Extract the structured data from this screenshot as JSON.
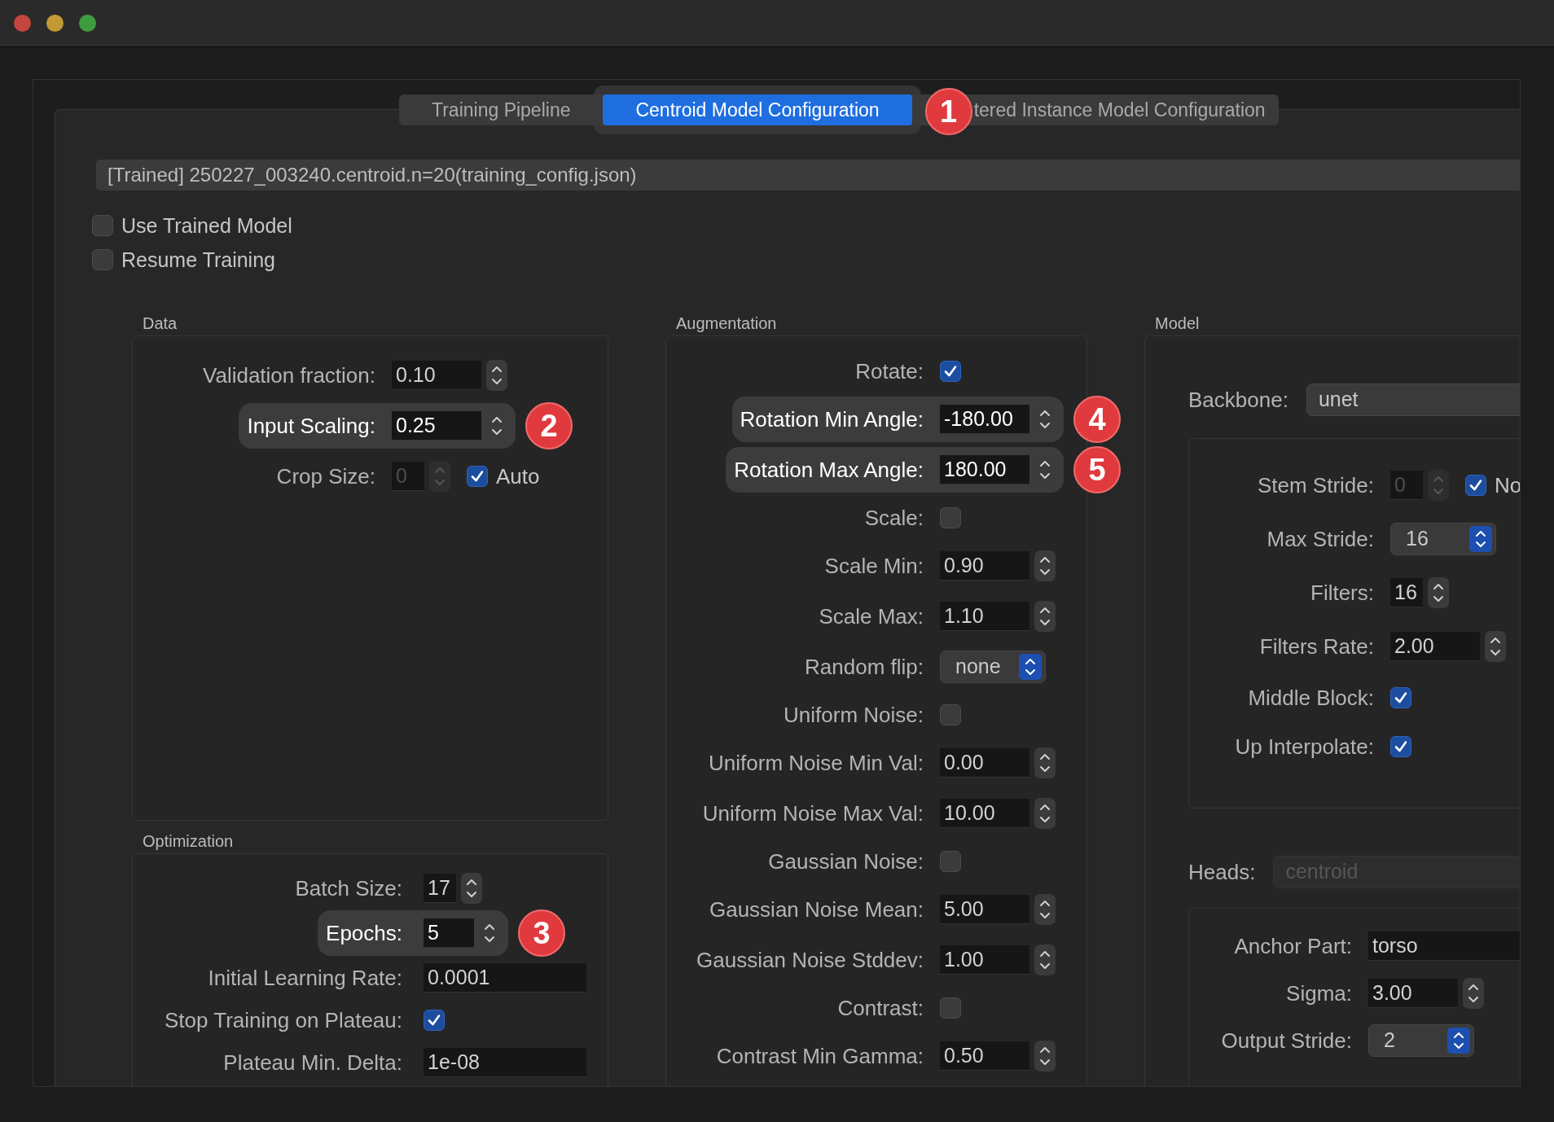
{
  "tabs": [
    {
      "label": "Training Pipeline",
      "selected": false
    },
    {
      "label": "Centroid Model Configuration",
      "selected": true,
      "callout": "1"
    },
    {
      "label": "tered Instance Model Configuration",
      "selected": false
    }
  ],
  "model_path": "[Trained] 250227_003240.centroid.n=20(training_config.json)",
  "options": [
    {
      "label": "Use Trained Model",
      "checked": false
    },
    {
      "label": "Resume Training",
      "checked": false
    }
  ],
  "columns": [
    {
      "groups": [
        {
          "title": "Data",
          "rows": [
            {
              "kind": "spin",
              "label": "Validation fraction:",
              "value": "0.10"
            },
            {
              "kind": "spin",
              "label": "Input Scaling:",
              "value": "0.25",
              "callout": "2"
            },
            {
              "kind": "int_spin",
              "label": "Crop Size:",
              "value": "0",
              "disabled": true,
              "extra": {
                "label": "Auto",
                "checked": true
              }
            }
          ]
        },
        {
          "title": "Optimization",
          "rows": [
            {
              "kind": "int_spin",
              "label": "Batch Size:",
              "value": "17",
              "disabled": false
            },
            {
              "kind": "int_spin",
              "label": "Epochs:",
              "value": "5",
              "disabled": false,
              "callout": "3"
            },
            {
              "kind": "text",
              "label": "Initial Learning Rate:",
              "value": "0.0001"
            },
            {
              "kind": "checkbox",
              "label": "Stop Training on Plateau:",
              "checked": true
            },
            {
              "kind": "text",
              "label": "Plateau Min. Delta:",
              "value": "1e-08"
            }
          ]
        }
      ]
    },
    {
      "groups": [
        {
          "title": "Augmentation",
          "rows": [
            {
              "kind": "checkbox",
              "label": "Rotate:",
              "checked": true
            },
            {
              "kind": "spin",
              "label": "Rotation Min Angle:",
              "value": "-180.00",
              "callout": "4"
            },
            {
              "kind": "spin",
              "label": "Rotation Max Angle:",
              "value": "180.00",
              "callout": "5"
            },
            {
              "kind": "checkbox",
              "label": "Scale:",
              "checked": false
            },
            {
              "kind": "spin",
              "label": "Scale Min:",
              "value": "0.90"
            },
            {
              "kind": "spin",
              "label": "Scale Max:",
              "value": "1.10"
            },
            {
              "kind": "select",
              "label": "Random flip:",
              "value": "none"
            },
            {
              "kind": "checkbox",
              "label": "Uniform Noise:",
              "checked": false
            },
            {
              "kind": "spin",
              "label": "Uniform Noise Min Val:",
              "value": "0.00"
            },
            {
              "kind": "spin",
              "label": "Uniform Noise Max Val:",
              "value": "10.00"
            },
            {
              "kind": "checkbox",
              "label": "Gaussian Noise:",
              "checked": false
            },
            {
              "kind": "spin",
              "label": "Gaussian Noise Mean:",
              "value": "5.00"
            },
            {
              "kind": "spin",
              "label": "Gaussian Noise Stddev:",
              "value": "1.00"
            },
            {
              "kind": "checkbox",
              "label": "Contrast:",
              "checked": false
            },
            {
              "kind": "spin",
              "label": "Contrast Min Gamma:",
              "value": "0.50"
            }
          ]
        }
      ]
    },
    {
      "groups": [
        {
          "title": "Model",
          "sections": [
            {
              "label": "Backbone:",
              "value": "unet",
              "disabled": false,
              "rows": [
                {
                  "kind": "int_spin",
                  "label": "Stem Stride:",
                  "value": "0",
                  "disabled": true,
                  "extra": {
                    "label": "No",
                    "checked": true
                  }
                },
                {
                  "kind": "select",
                  "label": "Max Stride:",
                  "value": "16"
                },
                {
                  "kind": "int_spin",
                  "label": "Filters:",
                  "value": "16",
                  "disabled": false
                },
                {
                  "kind": "spin",
                  "label": "Filters Rate:",
                  "value": "2.00"
                },
                {
                  "kind": "checkbox",
                  "label": "Middle Block:",
                  "checked": true
                },
                {
                  "kind": "checkbox",
                  "label": "Up Interpolate:",
                  "checked": true
                }
              ]
            },
            {
              "label": "Heads:",
              "value": "centroid",
              "disabled": true,
              "rows": [
                {
                  "kind": "text",
                  "label": "Anchor Part:",
                  "value": "torso"
                },
                {
                  "kind": "spin",
                  "label": "Sigma:",
                  "value": "3.00"
                },
                {
                  "kind": "select",
                  "label": "Output Stride:",
                  "value": "2"
                }
              ]
            }
          ]
        }
      ]
    }
  ]
}
